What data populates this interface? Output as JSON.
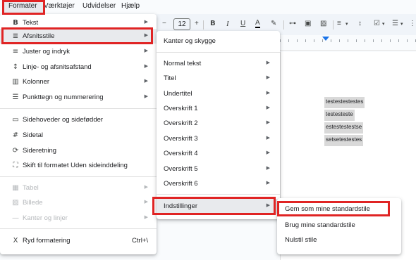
{
  "menubar": {
    "items": [
      "Formater",
      "Værktøjer",
      "Udvidelser",
      "Hjælp"
    ]
  },
  "toolbar": {
    "font_size": "12",
    "icons": [
      "minus-icon",
      "bold-icon",
      "italic-icon",
      "underline-icon",
      "text-color-icon",
      "highlight-icon",
      "link-icon",
      "comment-icon",
      "image-icon",
      "align-icon",
      "line-spacing-icon",
      "checklist-icon",
      "bullet-list-icon",
      "more-icon"
    ],
    "glyphs": {
      "minus": "−",
      "bold": "B",
      "italic": "I",
      "underline": "U",
      "text_color": "A",
      "highlight": "✎",
      "link": "⊶",
      "comment": "▣",
      "image": "▨",
      "align": "≡",
      "line_spacing": "↕",
      "checklist": "☑",
      "bullets": "☰",
      "more": "⋮"
    }
  },
  "format_menu": {
    "items": [
      {
        "label": "Tekst",
        "icon": "B",
        "arrow": "▶"
      },
      {
        "label": "Afsnitsstile",
        "icon": "≣",
        "arrow": "▶"
      },
      {
        "label": "Juster og indryk",
        "icon": "≡",
        "arrow": "▶"
      },
      {
        "label": "Linje- og afsnitsafstand",
        "icon": "↕",
        "arrow": "▶"
      },
      {
        "label": "Kolonner",
        "icon": "▥",
        "arrow": "▶"
      },
      {
        "label": "Punkttegn og nummerering",
        "icon": "☰",
        "arrow": "▶"
      },
      {
        "label": "Sidehoveder og sidefødder",
        "icon": "▭"
      },
      {
        "label": "Sidetal",
        "icon": "#"
      },
      {
        "label": "Sideretning",
        "icon": "⟳"
      },
      {
        "label": "Skift til formatet Uden sideinddeling",
        "icon": "⛶"
      },
      {
        "label": "Tabel",
        "icon": "▦",
        "arrow": "▶"
      },
      {
        "label": "Billede",
        "icon": "▨",
        "arrow": "▶"
      },
      {
        "label": "Kanter og linjer",
        "icon": "—",
        "arrow": "▶"
      },
      {
        "label": "Ryd formatering",
        "icon": "Ⅹ",
        "shortcut": "Ctrl+\\"
      }
    ]
  },
  "styles_menu": {
    "items": [
      {
        "label": "Kanter og skygge"
      },
      {
        "label": "Normal tekst",
        "arrow": "▶"
      },
      {
        "label": "Titel",
        "arrow": "▶"
      },
      {
        "label": "Undertitel",
        "arrow": "▶"
      },
      {
        "label": "Overskrift 1",
        "arrow": "▶"
      },
      {
        "label": "Overskrift 2",
        "arrow": "▶"
      },
      {
        "label": "Overskrift 3",
        "arrow": "▶"
      },
      {
        "label": "Overskrift 4",
        "arrow": "▶"
      },
      {
        "label": "Overskrift 5",
        "arrow": "▶"
      },
      {
        "label": "Overskrift 6",
        "arrow": "▶"
      },
      {
        "label": "Indstillinger",
        "arrow": "▶"
      }
    ]
  },
  "options_menu": {
    "items": [
      {
        "label": "Gem som mine standardstile"
      },
      {
        "label": "Brug mine standardstile"
      },
      {
        "label": "Nulstil stile"
      }
    ]
  },
  "document": {
    "lines": [
      "testestestestes",
      "testesteste",
      "estestestestse",
      "setsetestestes"
    ]
  },
  "colors": {
    "highlight_box": "#e02424",
    "selection": "#d9d9d9",
    "ruler_marker": "#1a73e8"
  }
}
